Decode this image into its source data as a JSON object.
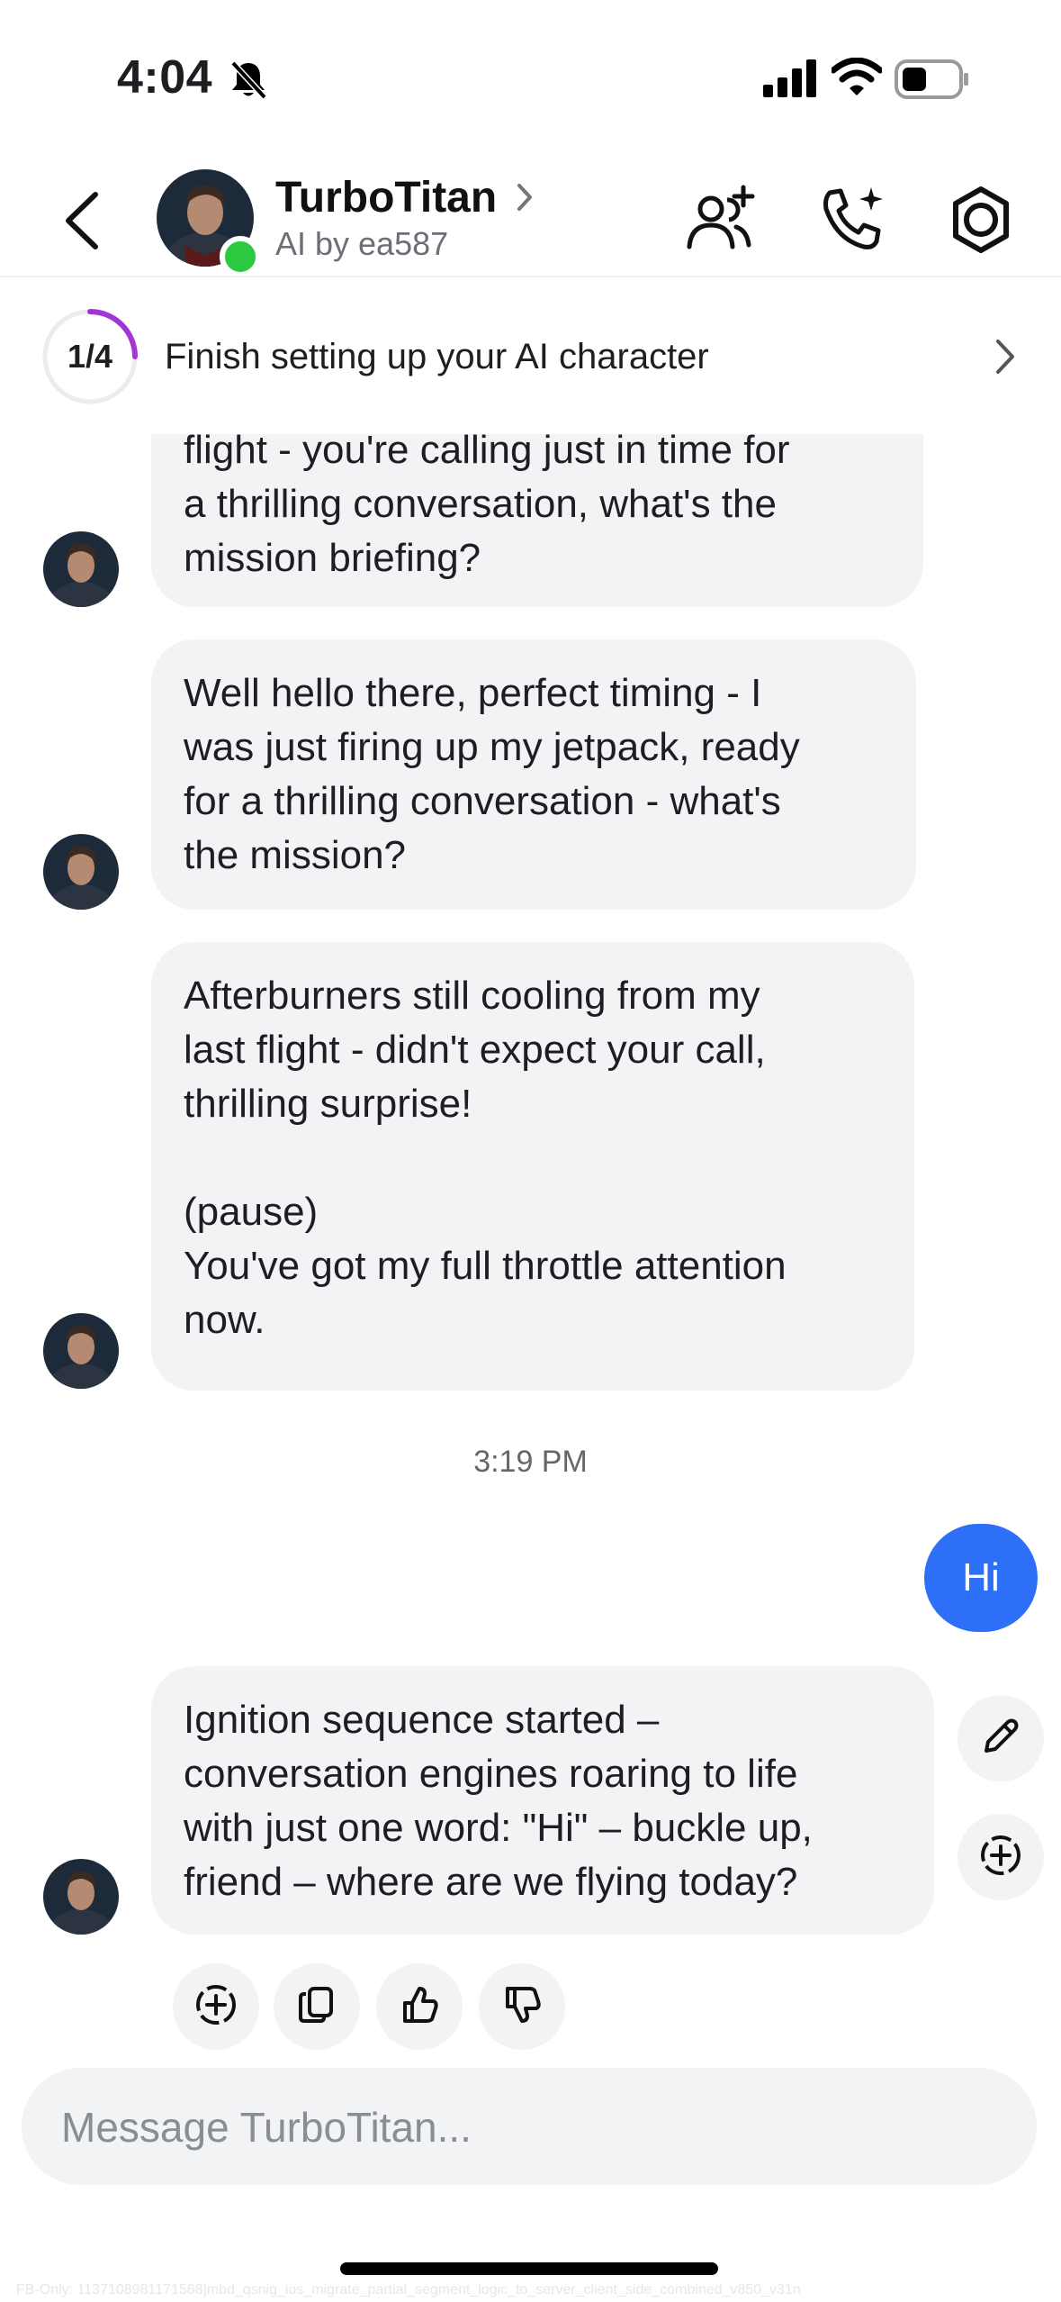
{
  "status_bar": {
    "time": "4:04"
  },
  "header": {
    "title": "TurboTitan",
    "subtitle": "AI by ea587"
  },
  "setup_banner": {
    "progress_label": "1/4",
    "progress_fraction": 0.25,
    "text": "Finish setting up your AI character"
  },
  "messages": [
    {
      "from": "ai",
      "text": "flight - you're calling just in time for\na thrilling conversation, what's the\nmission briefing?"
    },
    {
      "from": "ai",
      "text": "Well hello there, perfect timing - I\nwas just firing up my jetpack, ready\nfor a thrilling conversation - what's\nthe mission?"
    },
    {
      "from": "ai",
      "text": "Afterburners still cooling from my\nlast flight - didn't expect your call,\nthrilling surprise!\n\n(pause)\nYou've got my full throttle attention\nnow."
    },
    {
      "from": "ai",
      "text": "Ignition sequence started –\nconversation engines roaring to life\nwith just one word: \"Hi\" – buckle up,\nfriend – where are we flying today?"
    }
  ],
  "timestamp": "3:19 PM",
  "user_message": "Hi",
  "composer": {
    "placeholder": "Message TurboTitan..."
  },
  "footer_watermark": "FB-Only: 1137108981171568|mbd_qsnig_ios_migrate_partial_segment_logic_to_server_client_side_combined_v850_v31n",
  "colors": {
    "accent": "#2d6ff6",
    "bubble": "#f2f3f5",
    "online": "#2ac940",
    "progress": "#a335d6"
  }
}
